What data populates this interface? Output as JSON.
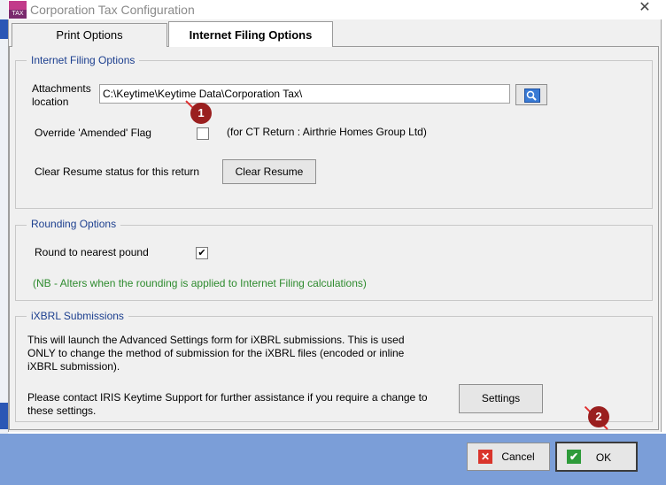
{
  "window": {
    "title": "Corporation Tax Configuration",
    "close_glyph": "✕",
    "app_icon_text": "TAX"
  },
  "tabs": [
    {
      "label": "Print Options"
    },
    {
      "label": "Internet Filing Options"
    }
  ],
  "internet_filing": {
    "legend": "Internet Filing Options",
    "attachments_label_line1": "Attachments",
    "attachments_label_line2": "location",
    "attachments_path": "C:\\Keytime\\Keytime Data\\Corporation Tax\\",
    "override_label": "Override 'Amended' Flag",
    "override_note": "(for CT Return : Airthrie Homes Group Ltd)",
    "clear_resume_label": "Clear Resume status for this return",
    "clear_resume_button": "Clear Resume"
  },
  "rounding": {
    "legend": "Rounding Options",
    "round_label": "Round to  nearest pound",
    "note": "(NB - Alters when the rounding is applied to Internet Filing calculations)",
    "checked_glyph": "✔"
  },
  "ixbrl": {
    "legend": "iXBRL Submissions",
    "line1": "This will launch the Advanced Settings form for iXBRL submissions. This is used",
    "line2": "ONLY to change the method of submission for the iXBRL files (encoded or inline",
    "line3": "iXBRL submission).",
    "contact_line1": "Please contact IRIS Keytime Support for further assistance if you require a change to",
    "contact_line2": "these settings.",
    "settings_button": "Settings"
  },
  "footer": {
    "cancel_label": "Cancel",
    "ok_label": "OK"
  },
  "markers": [
    "1",
    "2"
  ],
  "colors": {
    "legend": "#1c3f8f",
    "note_green": "#2e8b2e",
    "footer": "#7b9ed8",
    "marker": "#9a1f1f"
  }
}
